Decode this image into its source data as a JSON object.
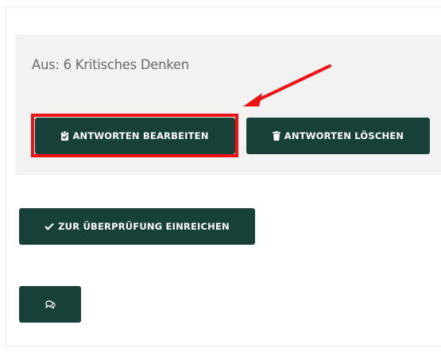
{
  "assignment": {
    "from_label": "Aus: 6 Kritisches Denken"
  },
  "actions": {
    "edit_label": "ANTWORTEN BEARBEITEN",
    "edit_icon": "clipboard-check-icon",
    "delete_label": "ANTWORTEN LÖSCHEN",
    "delete_icon": "trash-icon",
    "submit_label": "ZUR ÜBERPRÜFUNG EINREICHEN",
    "submit_icon": "checkmark-icon",
    "comment_icon": "comments-icon"
  },
  "colors": {
    "button_bg": "#174038",
    "panel_bg": "#f2f2f2",
    "highlight": "#ee1212",
    "label_text": "#6a6a6a"
  }
}
